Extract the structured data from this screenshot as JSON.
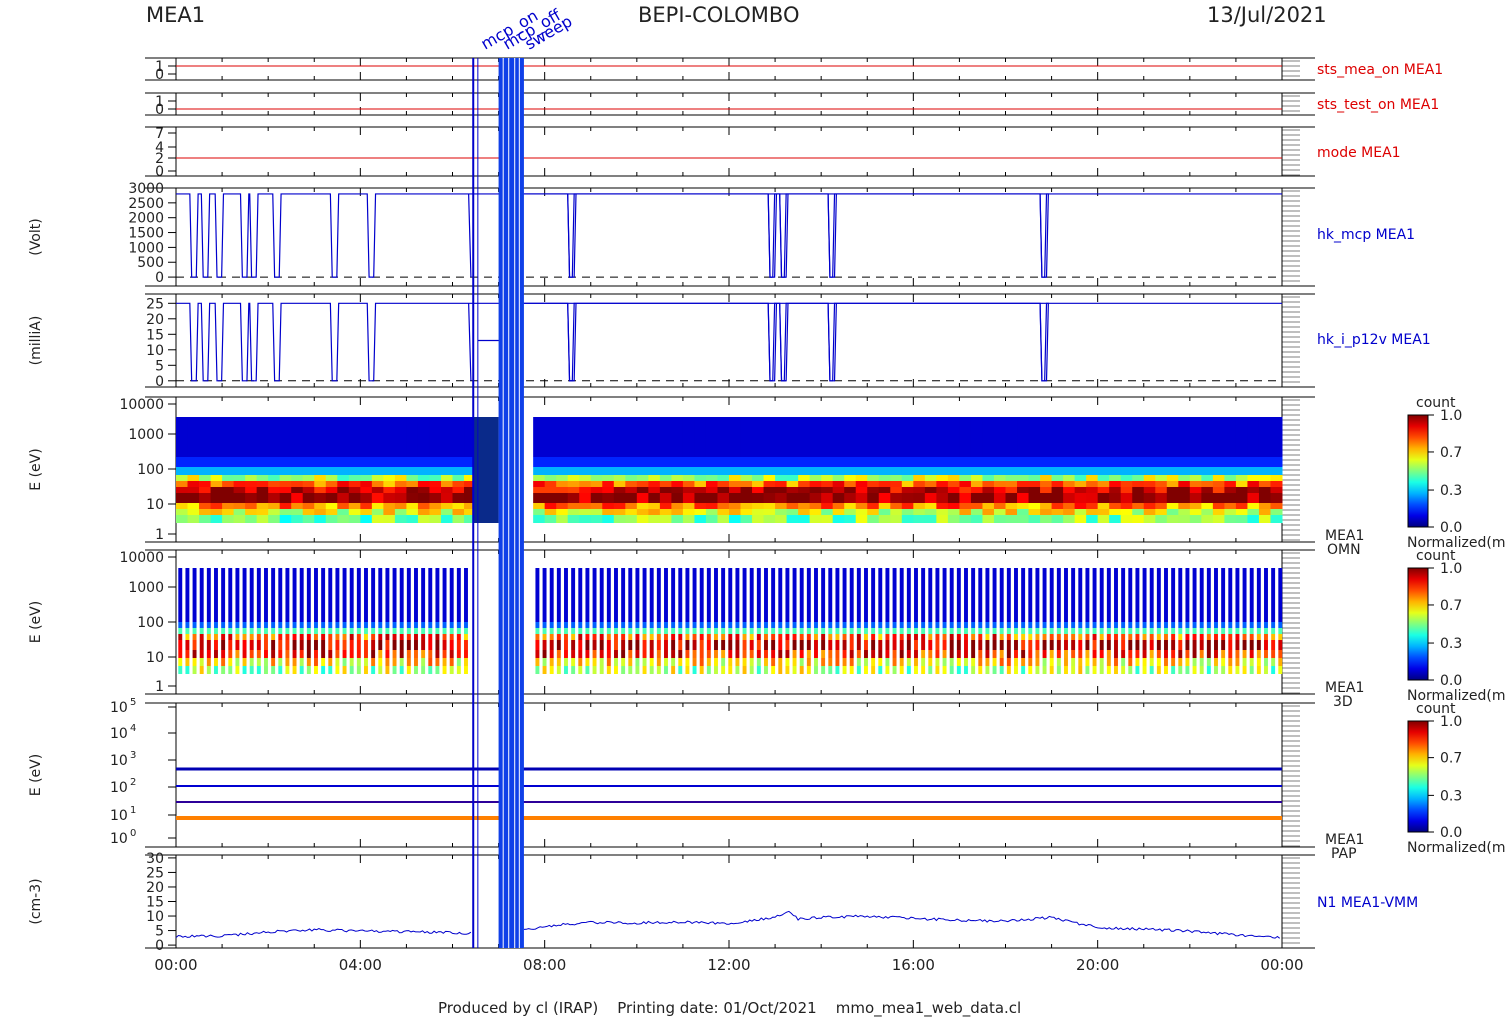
{
  "header": {
    "left": "MEA1",
    "center": "BEPI-COLOMBO",
    "right": "13/Jul/2021"
  },
  "footer": "Produced by cl (IRAP)    Printing date: 01/Oct/2021    mmo_mea1_web_data.cl",
  "top_annotations": [
    "mcp_on",
    "mcp_off",
    "sweep"
  ],
  "colors": {
    "red": "#dd0000",
    "blue": "#0000cc",
    "axis": "#000000"
  },
  "chart_data": [
    {
      "type": "line",
      "name": "sts_mea_on",
      "label": "sts_mea_on MEA1",
      "color": "red",
      "yticks": [
        "1",
        "0"
      ],
      "x": [
        0,
        24
      ],
      "y": [
        1,
        1
      ]
    },
    {
      "type": "line",
      "name": "sts_test_on",
      "label": "sts_test_on MEA1",
      "color": "red",
      "yticks": [
        "1",
        "0"
      ],
      "x": [
        0,
        24
      ],
      "y": [
        0,
        0
      ]
    },
    {
      "type": "line",
      "name": "mode",
      "label": "mode MEA1",
      "color": "red",
      "yticks": [
        "7",
        "4",
        "2",
        "0"
      ],
      "x": [
        0,
        24
      ],
      "y": [
        2,
        2
      ]
    },
    {
      "type": "line",
      "name": "hk_mcp",
      "label": "hk_mcp MEA1",
      "ylabel": "(Volt)",
      "color": "blue",
      "yticks": [
        "3000",
        "2500",
        "2000",
        "1500",
        "1000",
        "500",
        "0"
      ],
      "ylim": [
        -300,
        3000
      ],
      "high": 2800,
      "drops": [
        0.3,
        0.55,
        0.85,
        1.4,
        1.6,
        2.1,
        3.35,
        4.15,
        8.5,
        12.85,
        13.1,
        14.15,
        18.75
      ]
    },
    {
      "type": "line",
      "name": "hk_i_p12v",
      "label": "hk_i_p12v MEA1",
      "ylabel": "(milliA)",
      "color": "blue",
      "yticks": [
        "25",
        "20",
        "15",
        "10",
        "5",
        "0"
      ],
      "ylim": [
        -2,
        28
      ],
      "high": 25,
      "drops": [
        0.3,
        0.55,
        0.85,
        1.4,
        1.6,
        2.1,
        3.35,
        4.15,
        8.5,
        12.85,
        13.1,
        14.15,
        18.75
      ]
    },
    {
      "type": "heatmap",
      "name": "omni",
      "label": [
        "MEA1",
        "OMN"
      ],
      "ylabel": "E (eV)",
      "yticks": [
        "10000",
        "1000",
        "100",
        "10",
        "1"
      ],
      "zlabel": "count",
      "zticks": [
        "1.0",
        "0.7",
        "0.3",
        "0.0"
      ],
      "zfooter": "Normalized(m"
    },
    {
      "type": "heatmap",
      "name": "3d",
      "label": [
        "MEA1",
        "3D"
      ],
      "ylabel": "E (eV)",
      "yticks": [
        "10000",
        "1000",
        "100",
        "10",
        "1"
      ],
      "zlabel": "count",
      "zticks": [
        "1.0",
        "0.7",
        "0.3",
        "0.0"
      ],
      "zfooter": "Normalized(m"
    },
    {
      "type": "heatmap",
      "name": "pap",
      "label": [
        "MEA1",
        "PAP"
      ],
      "ylabel": "E (eV)",
      "yticks": [
        "5",
        "4",
        "3",
        "2",
        "1",
        "0"
      ],
      "yticks_base": "10",
      "zlabel": "count",
      "zticks": [
        "1.0",
        "0.7",
        "0.3",
        "0.0"
      ],
      "zfooter": "Normalized(m"
    },
    {
      "type": "line",
      "name": "n1",
      "label": "N1 MEA1-VMM",
      "ylabel": "(cm-3)",
      "color": "blue",
      "yticks": [
        "30",
        "25",
        "20",
        "15",
        "10",
        "5",
        "0"
      ],
      "ylim": [
        -1,
        31
      ],
      "x": [
        0,
        1,
        2,
        3,
        4,
        5,
        6,
        6.4,
        7.5,
        8,
        9,
        10,
        11,
        12,
        13,
        13.3,
        13.5,
        14,
        15,
        16,
        17,
        18,
        19,
        20,
        21,
        22,
        23,
        24
      ],
      "y": [
        3,
        3.2,
        4.5,
        5.3,
        4.8,
        4.6,
        4.2,
        4,
        4.8,
        6.5,
        7.8,
        7.6,
        8,
        7.5,
        9.5,
        11.5,
        9,
        9.5,
        10,
        9.2,
        8.5,
        8.2,
        9.5,
        6,
        5.5,
        4.8,
        3.5,
        2.5
      ]
    }
  ],
  "xaxis": {
    "ticks": [
      "00:00",
      "04:00",
      "08:00",
      "12:00",
      "16:00",
      "20:00",
      "00:00"
    ],
    "range": [
      0,
      24
    ]
  }
}
